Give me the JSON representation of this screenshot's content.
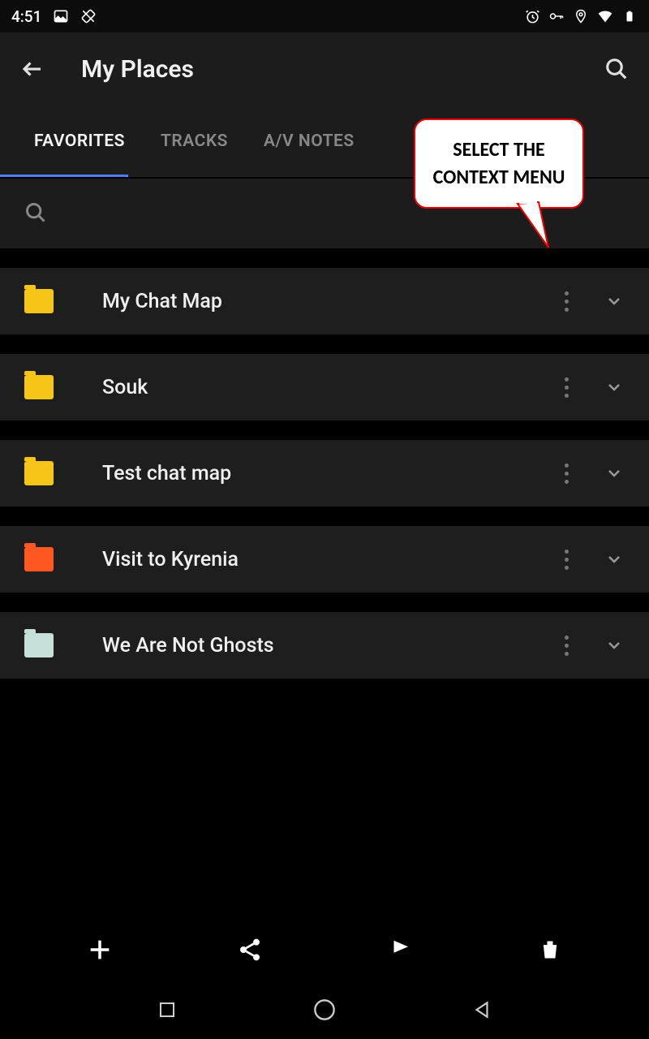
{
  "status": {
    "time": "4:51"
  },
  "header": {
    "title": "My Places"
  },
  "tabs": [
    {
      "label": "FAVORITES",
      "active": true
    },
    {
      "label": "TRACKS",
      "active": false
    },
    {
      "label": "A/V NOTES",
      "active": false
    }
  ],
  "items": [
    {
      "label": "My Chat Map",
      "color": "#f5c518"
    },
    {
      "label": "Souk",
      "color": "#f5c518"
    },
    {
      "label": "Test chat map",
      "color": "#f5c518"
    },
    {
      "label": "Visit to Kyrenia",
      "color": "#ff5722"
    },
    {
      "label": "We Are Not Ghosts",
      "color": "#c5e0d8"
    }
  ],
  "callout": {
    "line1": "SELECT THE",
    "line2": "CONTEXT MENU"
  }
}
